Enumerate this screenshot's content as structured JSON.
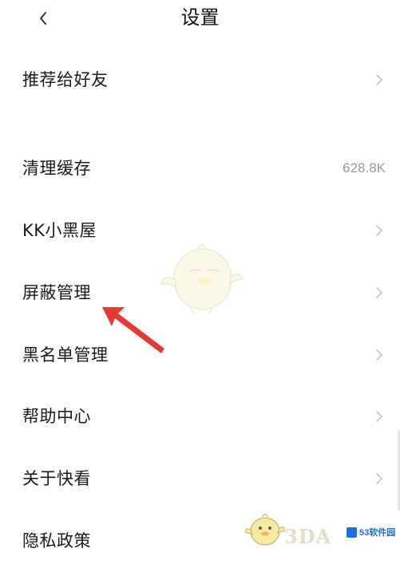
{
  "header": {
    "title": "设置",
    "back_icon": "chevron-left-icon"
  },
  "rows": [
    {
      "label": "推荐给好友",
      "value": null,
      "icon": "chevron-right-icon"
    },
    {
      "label": "清理缓存",
      "value": "628.8K",
      "icon": null
    },
    {
      "label": "KK小黑屋",
      "value": null,
      "icon": "chevron-right-icon"
    },
    {
      "label": "屏蔽管理",
      "value": null,
      "icon": "chevron-right-icon"
    },
    {
      "label": "黑名单管理",
      "value": null,
      "icon": "chevron-right-icon"
    },
    {
      "label": "帮助中心",
      "value": null,
      "icon": "chevron-right-icon"
    },
    {
      "label": "关于快看",
      "value": null,
      "icon": "chevron-right-icon"
    },
    {
      "label": "隐私政策",
      "value": null,
      "icon": null
    }
  ],
  "watermark": {
    "text_3d": "3DA",
    "logo_text": "53软件园"
  },
  "colors": {
    "background": "#ffffff",
    "text": "#1a1a1a",
    "secondary_text": "#9a9a9a",
    "chevron": "#c4c4c4",
    "annotation_arrow": "#e53935"
  }
}
